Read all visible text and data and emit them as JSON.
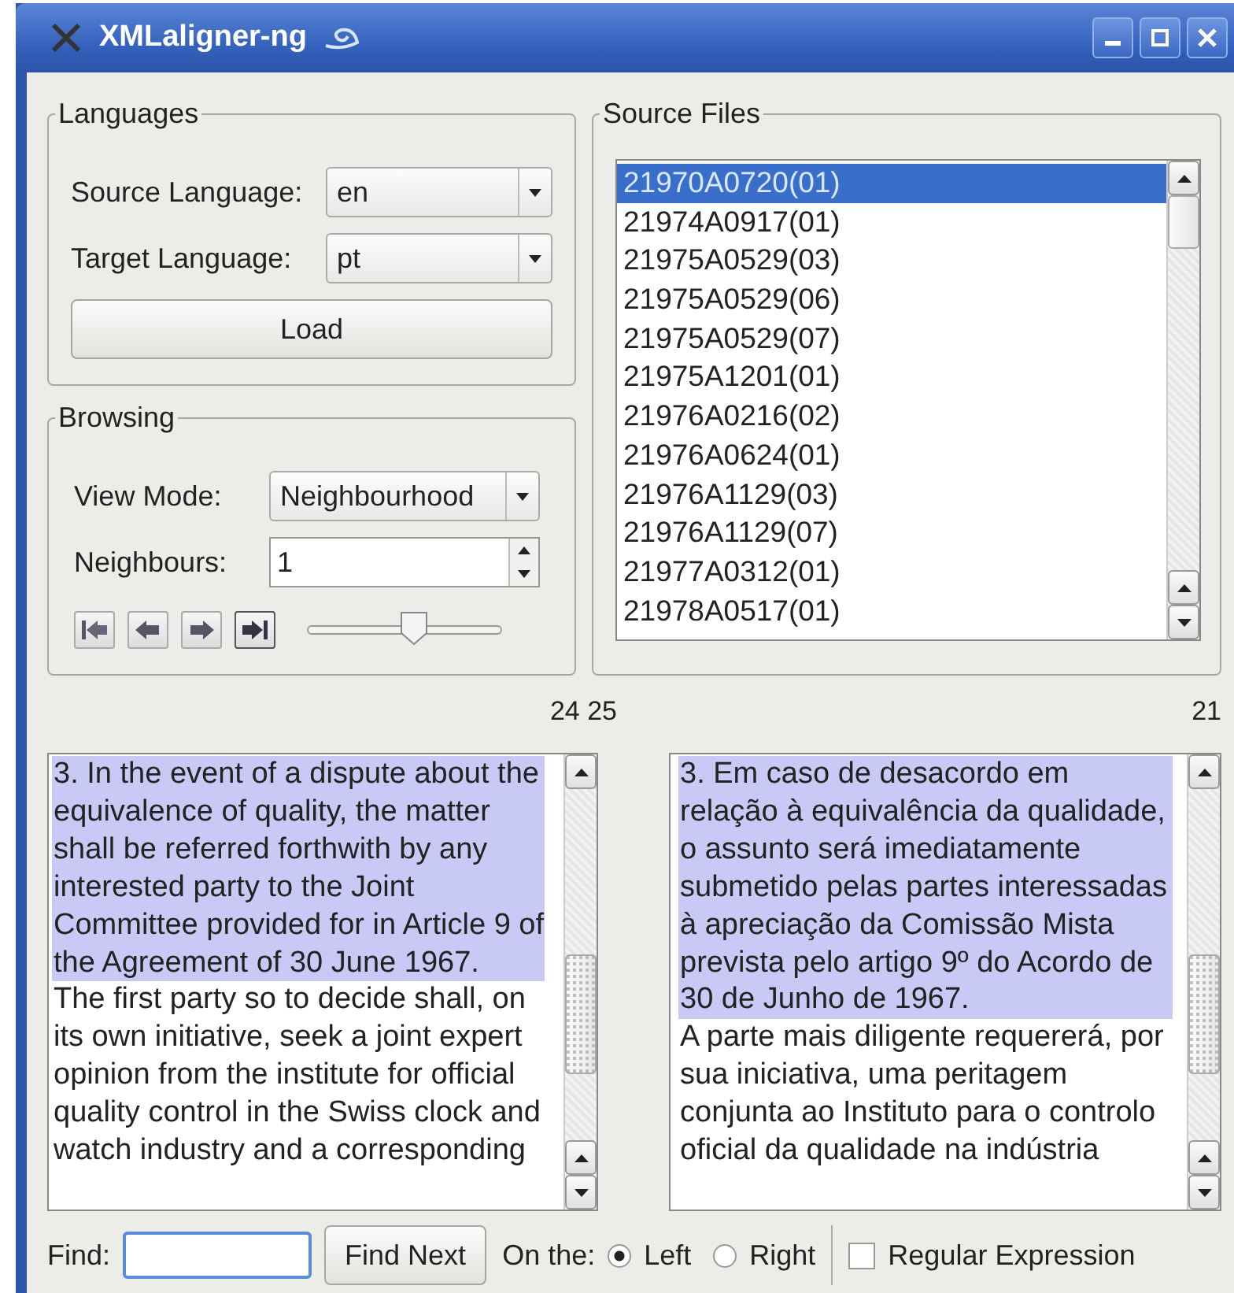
{
  "window": {
    "title": "XMLaligner-ng"
  },
  "languages": {
    "title": "Languages",
    "source": {
      "label": "Source Language:",
      "value": "en"
    },
    "target": {
      "label": "Target Language:",
      "value": "pt"
    },
    "load_button": "Load"
  },
  "browsing": {
    "title": "Browsing",
    "view_mode": {
      "label": "View Mode:",
      "value": "Neighbourhood"
    },
    "neighbours": {
      "label": "Neighbours:",
      "value": "1"
    },
    "slider": {
      "level": 0.55
    }
  },
  "source_files": {
    "title": "Source Files",
    "items": [
      {
        "label": "21970A0720(01)",
        "selected": true
      },
      {
        "label": "21974A0917(01)",
        "selected": false
      },
      {
        "label": "21975A0529(03)",
        "selected": false
      },
      {
        "label": "21975A0529(06)",
        "selected": false
      },
      {
        "label": "21975A0529(07)",
        "selected": false
      },
      {
        "label": "21975A1201(01)",
        "selected": false
      },
      {
        "label": "21976A0216(02)",
        "selected": false
      },
      {
        "label": "21976A0624(01)",
        "selected": false
      },
      {
        "label": "21976A1129(03)",
        "selected": false
      },
      {
        "label": "21976A1129(07)",
        "selected": false
      },
      {
        "label": "21977A0312(01)",
        "selected": false
      },
      {
        "label": "21978A0517(01)",
        "selected": false
      }
    ]
  },
  "panels": [
    {
      "counter": "24 25",
      "segments": [
        {
          "text": "3. In the event of a dispute about the equivalence of quality, the matter shall be referred forthwith by any interested party to the Joint Committee provided for in Article 9 of the Agreement of 30 June 1967.",
          "selected": true
        },
        {
          "text": "The first party so to decide shall, on its own initiative, seek a joint expert opinion from the institute for official quality control in the Swiss clock and watch industry and a corresponding",
          "selected": false
        }
      ]
    },
    {
      "counter": "21",
      "segments": [
        {
          "text": "3. Em caso de desacordo em relação à equivalência da qualidade, o assunto será imediatamente submetido pelas partes interessadas à apreciação da Comissão Mista prevista pelo artigo 9º do Acordo de 30 de Junho de 1967.",
          "selected": true
        },
        {
          "text": "A parte mais diligente requererá, por sua iniciativa, uma peritagem conjunta ao Instituto para o controlo oficial da qualidade na indústria",
          "selected": false
        }
      ]
    }
  ],
  "find_bar": {
    "label": "Find:",
    "button": "Find Next",
    "on_the": "On the:",
    "options": [
      {
        "label": "Left",
        "selected": true
      },
      {
        "label": "Right",
        "selected": false
      }
    ],
    "regex": {
      "label": "Regular Expression",
      "checked": false
    }
  }
}
